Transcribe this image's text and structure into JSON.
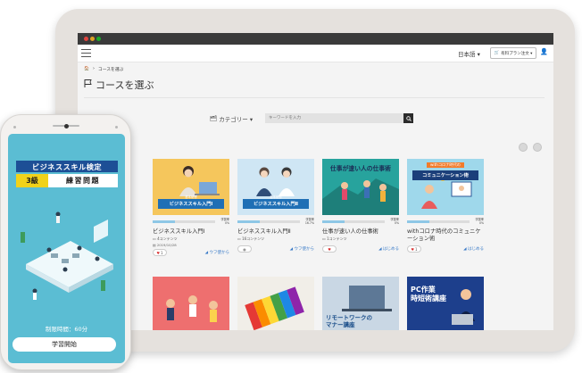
{
  "tablet": {
    "app_bar": {
      "language": "日本語 ▾",
      "plan_button": "有料プラン注文 ▾",
      "user_icon": "user-icon"
    },
    "breadcrumb": {
      "home_icon": "home-icon",
      "separator": "›",
      "current": "コースを選ぶ"
    },
    "page_title": "コースを選ぶ",
    "filter": {
      "category_label": "カテゴリー ▾",
      "search_placeholder": "キーワードを入力",
      "search_icon": "search-icon"
    },
    "courses": [
      {
        "thumb_caption": "ビジネススキル入門Ⅰ",
        "thumb_small": "基本研修",
        "progress": 0.0,
        "progress_label": "学習率\n0%",
        "title": "ビジネススキル入門Ⅰ",
        "meta": "4コンテンツ",
        "date": "2019/10/28",
        "likes": "1",
        "action": "ウフ使から",
        "action_icon": "send-icon"
      },
      {
        "thumb_caption": "ビジネススキル入門Ⅱ",
        "thumb_small": "基本研修",
        "progress": 0.167,
        "progress_label": "学習率\n16.7%",
        "title": "ビジネススキル入門Ⅱ",
        "meta": "16コンテンツ",
        "date": "",
        "likes": "",
        "action": "ウフ使から",
        "action_icon": "send-icon"
      },
      {
        "thumb_caption": "仕事が速い人の仕事術",
        "thumb_small": "",
        "progress": 0.0,
        "progress_label": "学習率\n0%",
        "title": "仕事が速い人の仕事術",
        "meta": "1コンテンツ",
        "date": "",
        "likes": "",
        "action": "はじめる",
        "action_icon": "send-icon"
      },
      {
        "thumb_caption": "コミュニケーション術",
        "thumb_small": "withコロナ時代の",
        "progress": 0.0,
        "progress_label": "学習率\n0%",
        "title": "withコロナ時代のコミュニケーション術",
        "meta": "",
        "date": "",
        "likes": "1",
        "action": "はじめる",
        "action_icon": "send-icon"
      }
    ],
    "second_row": [
      {
        "caption": ""
      },
      {
        "caption": ""
      },
      {
        "caption": "リモートワークの\nマナー講座"
      },
      {
        "caption": "PC作業\n時短術講座"
      }
    ]
  },
  "phone": {
    "exam_title": "ビジネススキル検定",
    "grade": "3級",
    "practice": "練習問題",
    "time_limit": "制限時間：60分",
    "start_button": "学習開始"
  }
}
